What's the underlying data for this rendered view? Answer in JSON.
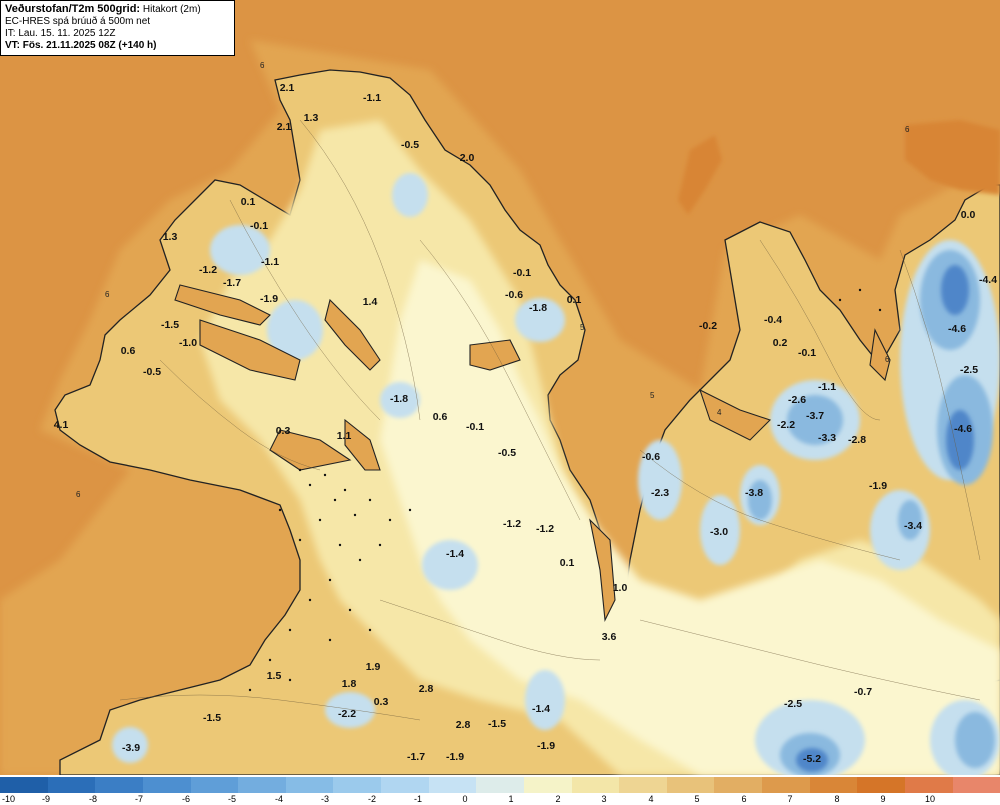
{
  "header": {
    "title": "Veðurstofan/T2m 500grid:",
    "subtitle": "Hitakort (2m)",
    "model": "EC-HRES spá brúuð á 500m net",
    "init_time": "IT: Lau. 15. 11. 2025 12Z",
    "valid_time": "VT: Fös. 21.11.2025 08Z (+140 h)"
  },
  "map_labels": [
    {
      "text": "2.1"
    },
    {
      "text": "-1.1"
    },
    {
      "text": "1.3"
    },
    {
      "text": "2.1"
    },
    {
      "text": "-0.5"
    },
    {
      "text": "2.0"
    },
    {
      "text": "0.1"
    },
    {
      "text": "-0.1"
    },
    {
      "text": "1.3"
    },
    {
      "text": "-1.2"
    },
    {
      "text": "-1.7"
    },
    {
      "text": "-1.1"
    },
    {
      "text": "-1.9"
    },
    {
      "text": "1.4"
    },
    {
      "text": "-0.1"
    },
    {
      "text": "-0.6"
    },
    {
      "text": "-1.8"
    },
    {
      "text": "0.1"
    },
    {
      "text": "-1.5"
    },
    {
      "text": "-1.0"
    },
    {
      "text": "0.6"
    },
    {
      "text": "-0.5"
    },
    {
      "text": "4.1"
    },
    {
      "text": "-1.8"
    },
    {
      "text": "0.6"
    },
    {
      "text": "-0.1"
    },
    {
      "text": "0.3"
    },
    {
      "text": "1.1"
    },
    {
      "text": "-0.5"
    },
    {
      "text": "-1.2"
    },
    {
      "text": "-1.2"
    },
    {
      "text": "-1.4"
    },
    {
      "text": "0.1"
    },
    {
      "text": "1.0"
    },
    {
      "text": "3.6"
    },
    {
      "text": "1.9"
    },
    {
      "text": "1.5"
    },
    {
      "text": "1.8"
    },
    {
      "text": "2.8"
    },
    {
      "text": "-1.5"
    },
    {
      "text": "-2.2"
    },
    {
      "text": "0.3"
    },
    {
      "text": "2.8"
    },
    {
      "text": "-1.5"
    },
    {
      "text": "-1.4"
    },
    {
      "text": "-3.9"
    },
    {
      "text": "-1.7"
    },
    {
      "text": "-1.9"
    },
    {
      "text": "-1.9"
    },
    {
      "text": "0.0"
    },
    {
      "text": "-4.4"
    },
    {
      "text": "-0.2"
    },
    {
      "text": "-0.4"
    },
    {
      "text": "0.2"
    },
    {
      "text": "-0.1"
    },
    {
      "text": "-4.6"
    },
    {
      "text": "-2.5"
    },
    {
      "text": "-1.1"
    },
    {
      "text": "-2.6"
    },
    {
      "text": "-3.7"
    },
    {
      "text": "-2.2"
    },
    {
      "text": "-3.3"
    },
    {
      "text": "-2.8"
    },
    {
      "text": "-4.6"
    },
    {
      "text": "-0.6"
    },
    {
      "text": "-2.3"
    },
    {
      "text": "-3.8"
    },
    {
      "text": "-1.9"
    },
    {
      "text": "-3.0"
    },
    {
      "text": "-3.4"
    },
    {
      "text": "-0.7"
    },
    {
      "text": "-2.5"
    },
    {
      "text": "-5.2"
    }
  ],
  "legend": {
    "ticks": [
      "-10",
      "-9",
      "-8",
      "-7",
      "-6",
      "-5",
      "-4",
      "-3",
      "-2",
      "-1",
      "0",
      "1",
      "2",
      "3",
      "4",
      "5",
      "6",
      "7",
      "8",
      "9",
      "10"
    ],
    "colors": [
      "#1f5fa8",
      "#2b6eb8",
      "#3b7ec5",
      "#4d8fd0",
      "#5f9ed8",
      "#73addf",
      "#86bce6",
      "#9bcaec",
      "#b0d6f1",
      "#c6e2f4",
      "#ddecea",
      "#f5f3c8",
      "#f3e6a8",
      "#eed593",
      "#e8c27a",
      "#e2ae63",
      "#dd9a4c",
      "#d98637",
      "#d57528",
      "#e07a48",
      "#e8866a"
    ]
  },
  "colors": {
    "sea": "#dc9444",
    "sea_light": "#e5ab57",
    "land_warm": "#ecc876",
    "land_mild": "#f6e7a8",
    "land_cool": "#fbf6cf",
    "cold_1": "#c5dfee",
    "cold_2": "#8ab9df",
    "cold_3": "#4f86c9"
  }
}
